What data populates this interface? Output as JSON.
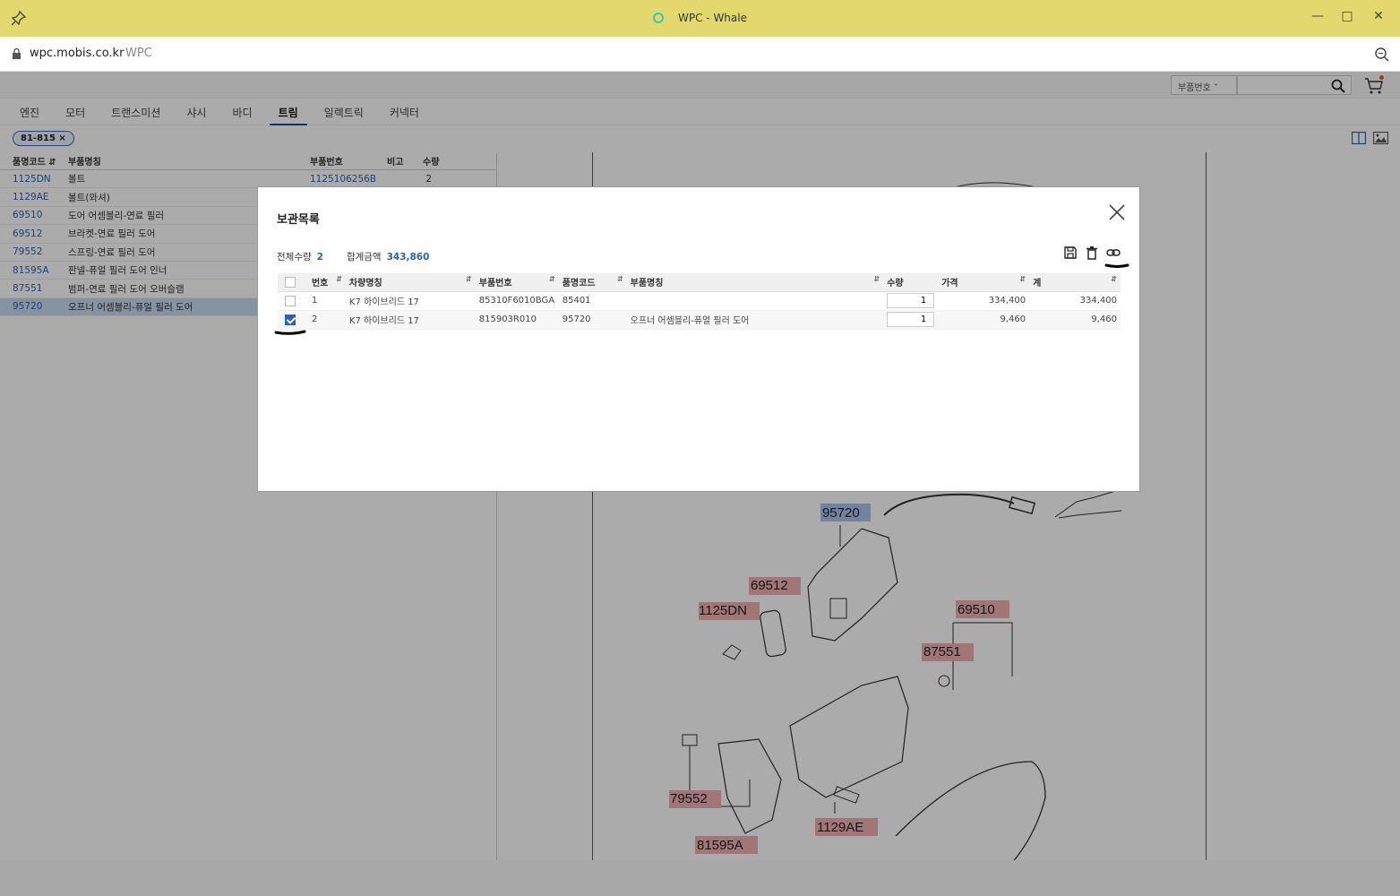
{
  "window": {
    "title": "WPC - Whale"
  },
  "address": {
    "url": "wpc.mobis.co.kr",
    "site": "WPC"
  },
  "search": {
    "select_label": "부품번호"
  },
  "categories": [
    {
      "label": "엔진",
      "active": false
    },
    {
      "label": "모터",
      "active": false
    },
    {
      "label": "트랜스미션",
      "active": false
    },
    {
      "label": "샤시",
      "active": false
    },
    {
      "label": "바디",
      "active": false
    },
    {
      "label": "트림",
      "active": true
    },
    {
      "label": "일렉트릭",
      "active": false
    },
    {
      "label": "커넥터",
      "active": false
    }
  ],
  "filter_chip": "81-815 ×",
  "parts_list": {
    "headers": {
      "code": "품명코드",
      "name": "부품명칭",
      "partno": "부품번호",
      "remark": "비고",
      "qty": "수량"
    },
    "rows": [
      {
        "code": "1125DN",
        "name": "볼트",
        "partno": "1125106256B",
        "qty": "2"
      },
      {
        "code": "1129AE",
        "name": "볼트(와셔)",
        "partno": "",
        "qty": ""
      },
      {
        "code": "69510",
        "name": "도어 어셈블리-연료 필러",
        "partno": "",
        "qty": ""
      },
      {
        "code": "69512",
        "name": "브라켓-연료 필러 도어",
        "partno": "",
        "qty": ""
      },
      {
        "code": "79552",
        "name": "스프링-연료 필러 도어",
        "partno": "",
        "qty": ""
      },
      {
        "code": "81595A",
        "name": "판넬-퓨얼 필러 도어 인너",
        "partno": "",
        "qty": ""
      },
      {
        "code": "87551",
        "name": "범퍼-연료 필러 도어 오버슬램",
        "partno": "",
        "qty": ""
      },
      {
        "code": "95720",
        "name": "오프너 어셈블리-퓨얼 필러 도어",
        "partno": "",
        "qty": ""
      }
    ]
  },
  "diagram_labels": [
    "95720",
    "69512",
    "1125DN",
    "69510",
    "87551",
    "79552",
    "81595A",
    "1129AE"
  ],
  "modal": {
    "title": "보관목록",
    "total_qty_label": "전체수량",
    "total_qty": "2",
    "total_price_label": "합계금액",
    "total_price": "343,860",
    "headers": {
      "no": "번호",
      "vehicle": "차량명칭",
      "partno": "부품번호",
      "code": "품명코드",
      "name": "부품명칭",
      "qty": "수량",
      "price": "가격",
      "total": "계"
    },
    "rows": [
      {
        "checked": false,
        "no": "1",
        "vehicle": "K7 하이브리드 17",
        "partno": "85310F6010BGA",
        "code": "85401",
        "name": "",
        "qty": "1",
        "price": "334,400",
        "total": "334,400"
      },
      {
        "checked": true,
        "no": "2",
        "vehicle": "K7 하이브리드 17",
        "partno": "815903R010",
        "code": "95720",
        "name": "오프너 어셈블리-퓨얼 필러 도어",
        "qty": "1",
        "price": "9,460",
        "total": "9,460"
      }
    ]
  },
  "colors": {
    "titlebar": "#e3d86e",
    "accent": "#2a62b8",
    "selected_row": "#c8dbf4"
  }
}
